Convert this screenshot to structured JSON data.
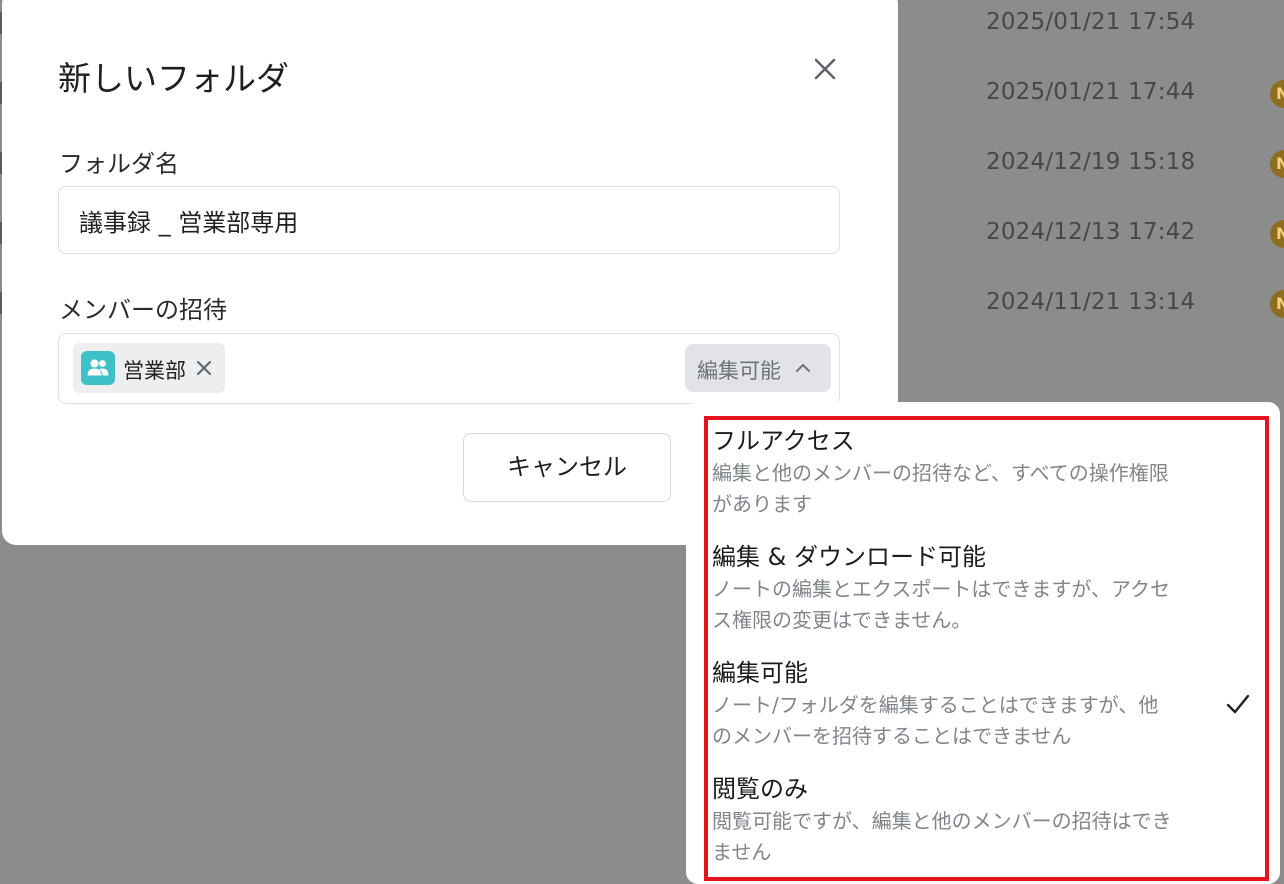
{
  "background_list": {
    "rows": [
      {
        "date": "2025/01/21 17:54",
        "avatar": ""
      },
      {
        "date": "2025/01/21 17:44",
        "avatar": "N"
      },
      {
        "date": "2024/12/19 15:18",
        "avatar": "N"
      },
      {
        "date": "2024/12/13 17:42",
        "avatar": "N"
      },
      {
        "date": "2024/11/21 13:14",
        "avatar": "N"
      }
    ]
  },
  "modal": {
    "title": "新しいフォルダ",
    "close_icon": "close-icon",
    "folder_name": {
      "label": "フォルダ名",
      "value": "議事録 _ 営業部専用"
    },
    "invite": {
      "label": "メンバーの招待",
      "member_chip": {
        "icon": "group-icon",
        "name": "営業部"
      },
      "permission_select": {
        "value": "編集可能",
        "icon": "chevron-up-icon"
      }
    },
    "cancel_label": "キャンセル"
  },
  "permission_menu": {
    "options": [
      {
        "title": "フルアクセス",
        "desc_lines": [
          "編集と他のメンバーの招待など、すべての操作権限",
          "があります"
        ],
        "selected": false
      },
      {
        "title": "編集 & ダウンロード可能",
        "desc_lines": [
          "ノートの編集とエクスポートはできますが、アクセ",
          "ス権限の変更はできません。"
        ],
        "selected": false
      },
      {
        "title": "編集可能",
        "desc_lines": [
          "ノート/フォルダを編集することはできますが、他",
          "のメンバーを招待することはできません"
        ],
        "selected": true
      },
      {
        "title": "閲覧のみ",
        "desc_lines": [
          "閲覧可能ですが、編集と他のメンバーの招待はでき",
          "ません"
        ],
        "selected": false
      }
    ],
    "check_icon": "check-icon"
  },
  "colors": {
    "overlay": "#8c8c8c",
    "accent_teal": "#3fc0c9",
    "highlight_red": "#e3141b",
    "avatar_gold": "#8d6d1f"
  }
}
